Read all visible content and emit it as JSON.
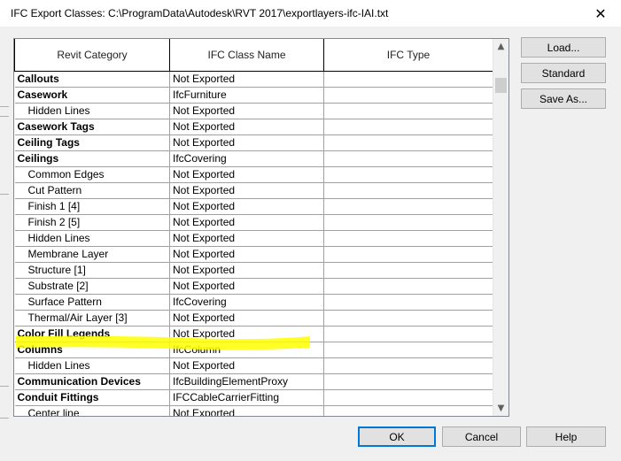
{
  "window": {
    "title": "IFC Export Classes: C:\\ProgramData\\Autodesk\\RVT 2017\\exportlayers-ifc-IAI.txt",
    "close_glyph": "✕"
  },
  "grid": {
    "headers": [
      "Revit Category",
      "IFC Class Name",
      "IFC Type"
    ],
    "rows": [
      {
        "category": "Callouts",
        "class": "Not Exported",
        "type": ""
      },
      {
        "category": "Casework",
        "class": "IfcFurniture",
        "type": ""
      },
      {
        "category": "Hidden Lines",
        "class": "Not Exported",
        "type": ""
      },
      {
        "category": "Casework Tags",
        "class": "Not Exported",
        "type": ""
      },
      {
        "category": "Ceiling Tags",
        "class": "Not Exported",
        "type": ""
      },
      {
        "category": "Ceilings",
        "class": "IfcCovering",
        "type": ""
      },
      {
        "category": "Common Edges",
        "class": "Not Exported",
        "type": ""
      },
      {
        "category": "Cut Pattern",
        "class": "Not Exported",
        "type": ""
      },
      {
        "category": "Finish 1 [4]",
        "class": "Not Exported",
        "type": ""
      },
      {
        "category": "Finish 2 [5]",
        "class": "Not Exported",
        "type": ""
      },
      {
        "category": "Hidden Lines",
        "class": "Not Exported",
        "type": ""
      },
      {
        "category": "Membrane Layer",
        "class": "Not Exported",
        "type": ""
      },
      {
        "category": "Structure [1]",
        "class": "Not Exported",
        "type": ""
      },
      {
        "category": "Substrate [2]",
        "class": "Not Exported",
        "type": ""
      },
      {
        "category": "Surface Pattern",
        "class": "IfcCovering",
        "type": ""
      },
      {
        "category": "Thermal/Air Layer [3]",
        "class": "Not Exported",
        "type": ""
      },
      {
        "category": "Color Fill Legends",
        "class": "Not Exported",
        "type": ""
      },
      {
        "category": "Columns",
        "class": "IfcColumn",
        "type": ""
      },
      {
        "category": "Hidden Lines",
        "class": "Not Exported",
        "type": ""
      },
      {
        "category": "Communication Devices",
        "class": "IfcBuildingElementProxy",
        "type": ""
      },
      {
        "category": "Conduit Fittings",
        "class": "IFCCableCarrierFitting",
        "type": ""
      },
      {
        "category": "Center line",
        "class": "Not Exported",
        "type": ""
      }
    ],
    "row_kinds": [
      "bold",
      "bold",
      "sub",
      "bold",
      "bold",
      "bold",
      "sub",
      "sub",
      "sub",
      "sub",
      "sub",
      "sub",
      "sub",
      "sub",
      "sub",
      "sub",
      "bold",
      "bold",
      "sub",
      "bold",
      "bold",
      "sub"
    ],
    "highlighted_row": 14,
    "highlight_color": "#ffff00",
    "scroll_up_glyph": "▲",
    "scroll_down_glyph": "▼"
  },
  "side_buttons": {
    "load": "Load...",
    "standard": "Standard",
    "save_as": "Save As..."
  },
  "footer_buttons": {
    "ok": "OK",
    "cancel": "Cancel",
    "help": "Help"
  }
}
